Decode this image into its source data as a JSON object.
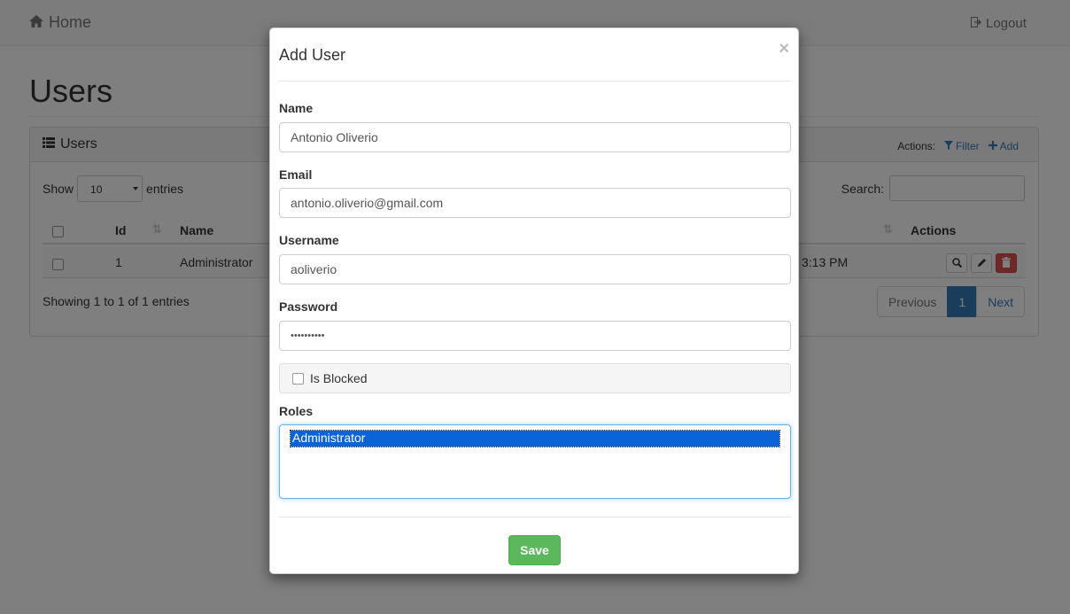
{
  "navbar": {
    "brand": "Home",
    "logout": "Logout"
  },
  "page": {
    "title": "Users"
  },
  "panel": {
    "title": "Users",
    "actions_label": "Actions:",
    "filter": "Filter",
    "add": "Add"
  },
  "table": {
    "show_label": "Show",
    "entries_label": "entries",
    "page_length": "10",
    "search_label": "Search:",
    "columns": {
      "id": "Id",
      "name": "Name",
      "actions": "Actions"
    },
    "rows": [
      {
        "id": "1",
        "name": "Administrator",
        "date_fragment": "3:13 PM"
      }
    ],
    "info": "Showing 1 to 1 of 1 entries",
    "pager": {
      "previous": "Previous",
      "current": "1",
      "next": "Next"
    }
  },
  "modal": {
    "title": "Add User",
    "close": "×",
    "name_label": "Name",
    "name_value": "Antonio Oliverio",
    "email_label": "Email",
    "email_value": "antonio.oliverio@gmail.com",
    "username_label": "Username",
    "username_value": "aoliverio",
    "password_label": "Password",
    "password_value": "••••••••••",
    "blocked_label": "Is Blocked",
    "roles_label": "Roles",
    "roles": [
      "Administrator"
    ],
    "save": "Save"
  },
  "colors": {
    "primary": "#337ab7",
    "success": "#5cb85c",
    "danger": "#d9534f",
    "selection": "#0a64d8"
  }
}
